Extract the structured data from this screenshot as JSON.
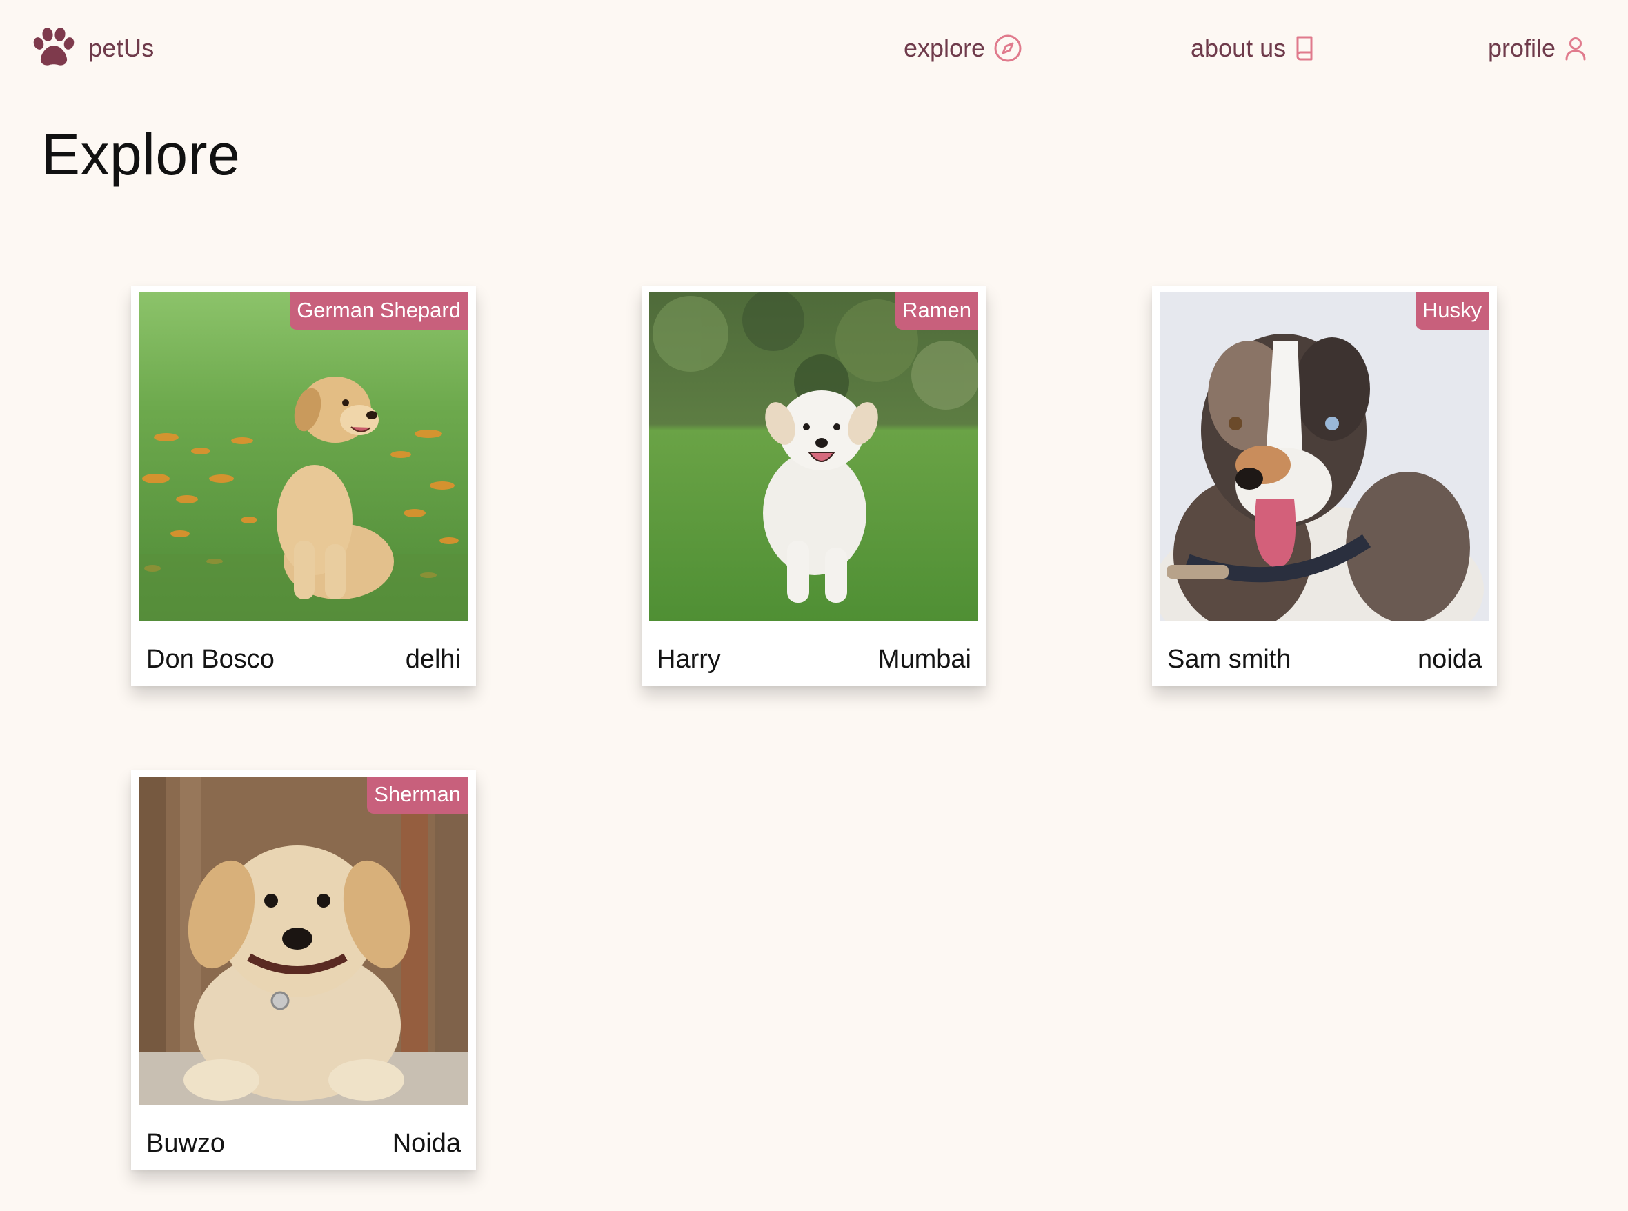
{
  "brand": {
    "name": "petUs",
    "icon": "paw-icon"
  },
  "nav": {
    "explore": {
      "label": "explore",
      "icon": "compass-icon"
    },
    "about": {
      "label": "about us",
      "icon": "book-icon"
    },
    "profile": {
      "label": "profile",
      "icon": "user-icon"
    }
  },
  "page": {
    "title": "Explore"
  },
  "colors": {
    "background": "#fdf8f3",
    "brand": "#6f3b4b",
    "accent": "#c8607c",
    "icon_accent": "#e07a8c"
  },
  "pets": [
    {
      "name": "Don Bosco",
      "location": "delhi",
      "breed": "German Shepard",
      "photo": "golden-puppy-in-flower-field"
    },
    {
      "name": "Harry",
      "location": "Mumbai",
      "breed": "Ramen",
      "photo": "white-puppy-running-on-grass"
    },
    {
      "name": "Sam smith",
      "location": "noida",
      "breed": "Husky",
      "photo": "merle-australian-shepherd"
    },
    {
      "name": "Buwzo",
      "location": "Noida",
      "breed": "Sherman",
      "photo": "golden-retriever-puppy-lying"
    }
  ]
}
